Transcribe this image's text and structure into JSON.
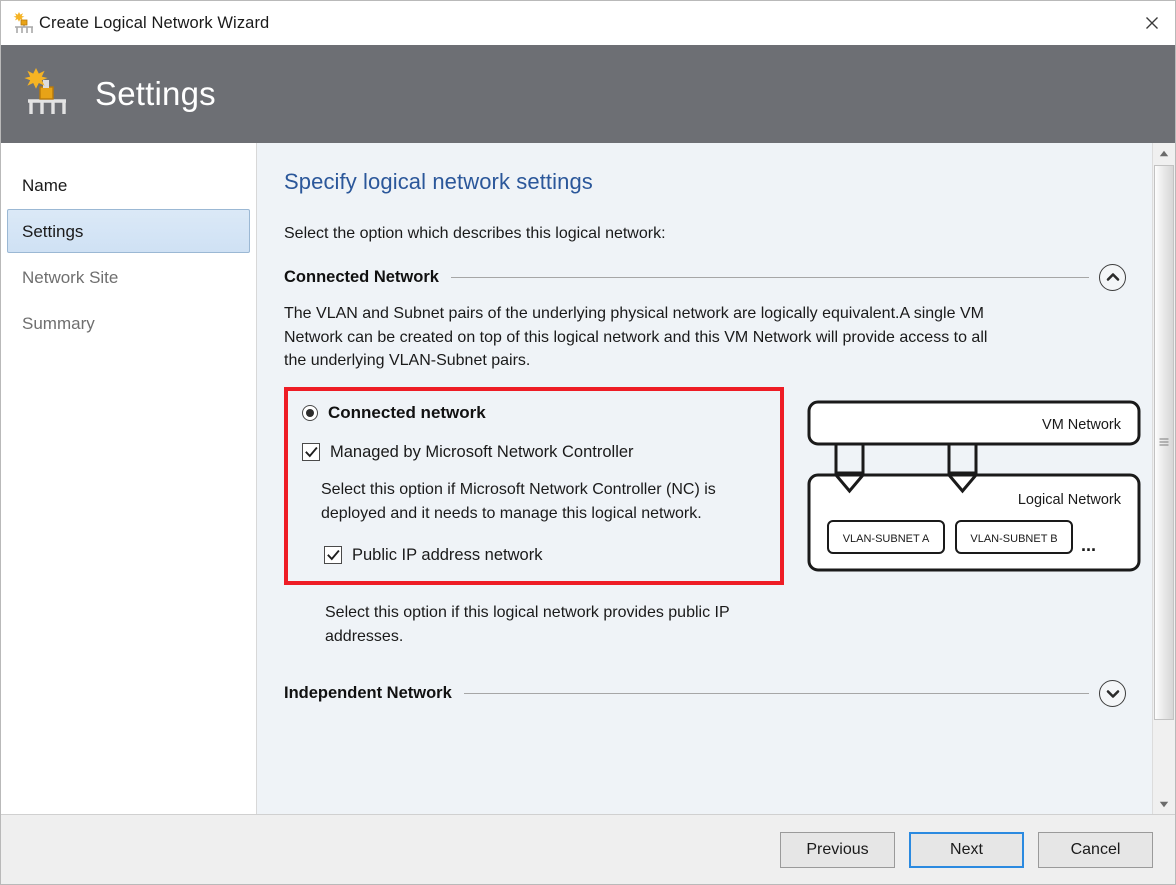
{
  "window": {
    "title": "Create Logical Network Wizard",
    "icon": "logical-network-icon",
    "close_label": "×"
  },
  "header": {
    "title": "Settings",
    "icon": "logical-network-icon"
  },
  "sidebar": {
    "items": [
      {
        "label": "Name",
        "state": "done"
      },
      {
        "label": "Settings",
        "state": "selected"
      },
      {
        "label": "Network Site",
        "state": "upcoming"
      },
      {
        "label": "Summary",
        "state": "upcoming"
      }
    ]
  },
  "main": {
    "page_title": "Specify logical network settings",
    "intro": "Select the option which describes this logical network:",
    "connected_section": {
      "label": "Connected Network",
      "toggle_icon": "chevron-up-icon",
      "expanded": true,
      "description": "The VLAN and Subnet pairs of the underlying physical network are logically equivalent.A single VM Network can be created on top of this logical network and this VM Network will provide access to all the underlying VLAN-Subnet pairs.",
      "radio": {
        "label": "Connected network",
        "selected": true
      },
      "managed_checkbox": {
        "label": "Managed by Microsoft Network Controller",
        "checked": true
      },
      "managed_help": "Select this option if Microsoft Network Controller (NC) is deployed and it needs to manage this logical network.",
      "public_ip_checkbox": {
        "label": "Public IP address network",
        "checked": true
      },
      "public_ip_help": "Select this option if this logical network provides public IP addresses."
    },
    "independent_section": {
      "label": "Independent Network",
      "toggle_icon": "chevron-down-icon",
      "expanded": false
    },
    "diagram": {
      "vm_network_label": "VM Network",
      "logical_network_label": "Logical  Network",
      "subnet_a_label": "VLAN-SUBNET A",
      "subnet_b_label": "VLAN-SUBNET B",
      "ellipsis": "..."
    },
    "highlight_color": "#ee1c25"
  },
  "scrollbar": {
    "up_icon": "triangle-up-icon",
    "down_icon": "triangle-down-icon"
  },
  "footer": {
    "previous_label": "Previous",
    "next_label": "Next",
    "cancel_label": "Cancel"
  }
}
